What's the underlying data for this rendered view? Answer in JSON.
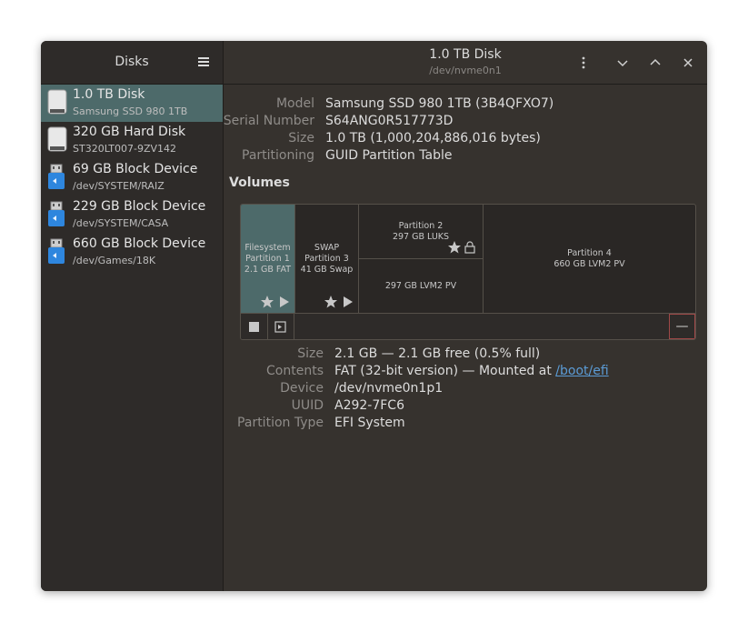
{
  "sidebar": {
    "title": "Disks",
    "items": [
      {
        "name": "1.0 TB Disk",
        "sub": "Samsung SSD 980 1TB",
        "icon": "hard-disk-icon"
      },
      {
        "name": "320 GB Hard Disk",
        "sub": "ST320LT007-9ZV142",
        "icon": "hard-disk-icon"
      },
      {
        "name": "69 GB Block Device",
        "sub": "/dev/SYSTEM/RAIZ",
        "icon": "block-device-icon"
      },
      {
        "name": "229 GB Block Device",
        "sub": "/dev/SYSTEM/CASA",
        "icon": "block-device-icon"
      },
      {
        "name": "660 GB Block Device",
        "sub": "/dev/Games/18K",
        "icon": "block-device-icon"
      }
    ]
  },
  "header": {
    "title": "1.0 TB Disk",
    "subtitle": "/dev/nvme0n1"
  },
  "disk_info": {
    "model_label": "Model",
    "model": "Samsung SSD 980 1TB (3B4QFXO7)",
    "serial_label": "Serial Number",
    "serial": "S64ANG0R517773D",
    "size_label": "Size",
    "size": "1.0 TB (1,000,204,886,016 bytes)",
    "partitioning_label": "Partitioning",
    "partitioning": "GUID Partition Table"
  },
  "volumes": {
    "heading": "Volumes",
    "p1": {
      "l1": "Filesystem",
      "l2": "Partition 1",
      "l3": "2.1 GB FAT"
    },
    "p3": {
      "l1": "SWAP",
      "l2": "Partition 3",
      "l3": "41 GB Swap"
    },
    "p2": {
      "l1": "Partition 2",
      "l2": "297 GB LUKS"
    },
    "p2_inner": "297 GB LVM2 PV",
    "p4": {
      "l1": "Partition 4",
      "l2": "660 GB LVM2 PV"
    },
    "minus": "—"
  },
  "partition_info": {
    "size_label": "Size",
    "size": "2.1 GB — 2.1 GB free (0.5% full)",
    "contents_label": "Contents",
    "contents_prefix": "FAT (32-bit version) — Mounted at",
    "contents_link": "/boot/efi",
    "device_label": "Device",
    "device": "/dev/nvme0n1p1",
    "uuid_label": "UUID",
    "uuid": "A292-7FC6",
    "type_label": "Partition Type",
    "type": "EFI System"
  },
  "colors": {
    "selection": "#4d6a6a",
    "link": "#5b9bd5",
    "window_bg": "#36322e"
  }
}
